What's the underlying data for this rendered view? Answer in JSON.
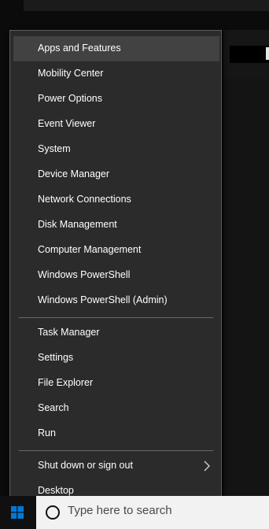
{
  "background": {
    "desktop_color": "#0b0b0b"
  },
  "menu": {
    "group1": [
      {
        "label": "Apps and Features",
        "highlighted": true
      },
      {
        "label": "Mobility Center"
      },
      {
        "label": "Power Options"
      },
      {
        "label": "Event Viewer"
      },
      {
        "label": "System"
      },
      {
        "label": "Device Manager"
      },
      {
        "label": "Network Connections"
      },
      {
        "label": "Disk Management"
      },
      {
        "label": "Computer Management"
      },
      {
        "label": "Windows PowerShell"
      },
      {
        "label": "Windows PowerShell (Admin)"
      }
    ],
    "group2": [
      {
        "label": "Task Manager"
      },
      {
        "label": "Settings"
      },
      {
        "label": "File Explorer"
      },
      {
        "label": "Search"
      },
      {
        "label": "Run"
      }
    ],
    "group3": [
      {
        "label": "Shut down or sign out",
        "has_submenu": true,
        "icon": "chevron-right-icon"
      },
      {
        "label": "Desktop"
      }
    ],
    "colors": {
      "background": "#2b2b2b",
      "highlight": "#424242",
      "text": "#ffffff",
      "separator": "#6a6a6a"
    }
  },
  "taskbar": {
    "start_icon": "windows-logo-icon",
    "search": {
      "icon": "cortana-circle-icon",
      "placeholder": "Type here to search"
    },
    "colors": {
      "accent": "#0078d7"
    }
  }
}
